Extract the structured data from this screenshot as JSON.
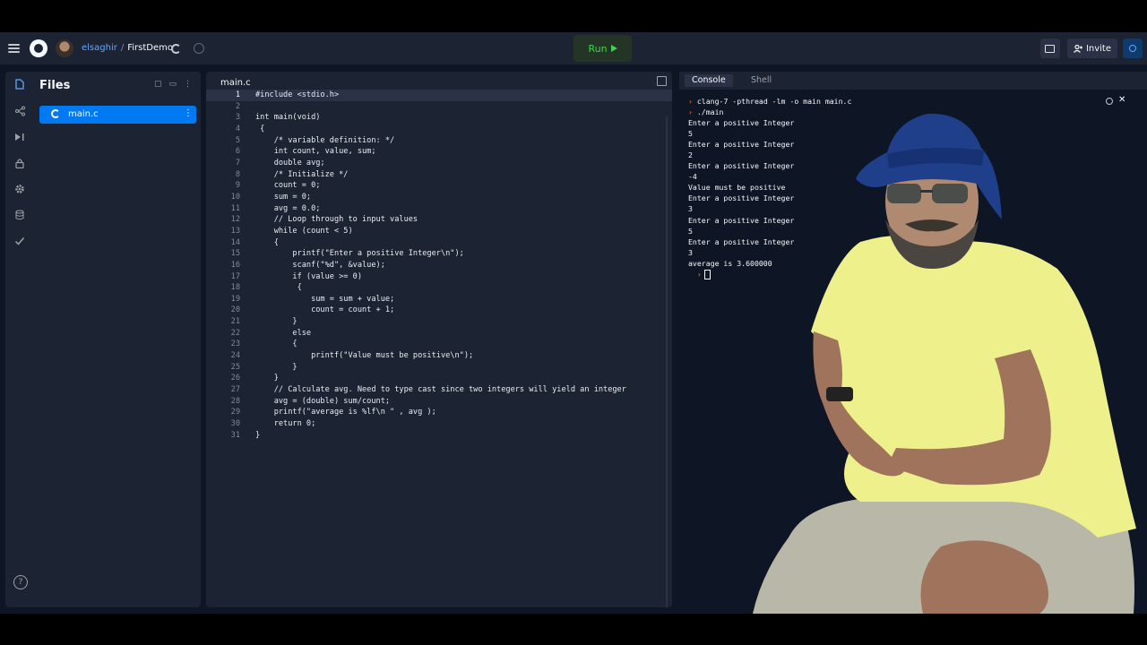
{
  "header": {
    "user": "elsaghir",
    "separator": "/",
    "project": "FirstDemo",
    "run_label": "Run",
    "invite_label": "Invite"
  },
  "sidebar": {
    "title": "Files",
    "files": [
      {
        "name": "main.c"
      }
    ]
  },
  "editor": {
    "tab": "main.c",
    "active_line": 1,
    "lines": [
      "#include <stdio.h>",
      "",
      "int main(void)",
      " {",
      "    /* variable definition: */",
      "    int count, value, sum;",
      "    double avg;",
      "    /* Initialize */",
      "    count = 0;",
      "    sum = 0;",
      "    avg = 0.0;",
      "    // Loop through to input values",
      "    while (count < 5)",
      "    {",
      "        printf(\"Enter a positive Integer\\n\");",
      "        scanf(\"%d\", &value);",
      "        if (value >= 0)",
      "         {",
      "            sum = sum + value;",
      "            count = count + 1;",
      "        }",
      "        else",
      "        {",
      "            printf(\"Value must be positive\\n\");",
      "        }",
      "    }",
      "    // Calculate avg. Need to type cast since two integers will yield an integer",
      "    avg = (double) sum/count;",
      "    printf(\"average is %lf\\n \" , avg );",
      "    return 0;",
      "}"
    ]
  },
  "console": {
    "tabs": [
      "Console",
      "Shell"
    ],
    "active_tab": "Console",
    "output": [
      {
        "prompt": "›",
        "text": "clang-7 -pthread -lm -o main main.c"
      },
      {
        "prompt": "›",
        "text": "./main"
      },
      {
        "prompt": "",
        "text": "Enter a positive Integer"
      },
      {
        "prompt": "",
        "text": "5"
      },
      {
        "prompt": "",
        "text": "Enter a positive Integer"
      },
      {
        "prompt": "",
        "text": "2"
      },
      {
        "prompt": "",
        "text": "Enter a positive Integer"
      },
      {
        "prompt": "",
        "text": "-4"
      },
      {
        "prompt": "",
        "text": "Value must be positive"
      },
      {
        "prompt": "",
        "text": "Enter a positive Integer"
      },
      {
        "prompt": "",
        "text": "3"
      },
      {
        "prompt": "",
        "text": "Enter a positive Integer"
      },
      {
        "prompt": "",
        "text": "5"
      },
      {
        "prompt": "",
        "text": "Enter a positive Integer"
      },
      {
        "prompt": "",
        "text": "3"
      },
      {
        "prompt": "",
        "text": "average is 3.600000"
      }
    ],
    "final_prompt": "›"
  }
}
